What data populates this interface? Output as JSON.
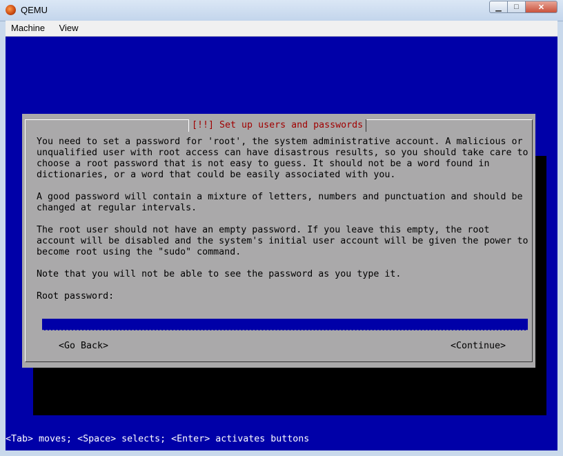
{
  "window": {
    "title": "QEMU",
    "minimize_label": "▁",
    "maximize_label": "□",
    "close_label": "✕"
  },
  "menu": [
    "Machine",
    "View"
  ],
  "dialog": {
    "title": "[!!] Set up users and passwords",
    "paragraphs": [
      "You need to set a password for 'root', the system administrative account. A malicious or\nunqualified user with root access can have disastrous results, so you should take care to\nchoose a root password that is not easy to guess. It should not be a word found in\ndictionaries, or a word that could be easily associated with you.",
      "A good password will contain a mixture of letters, numbers and punctuation and should be\nchanged at regular intervals.",
      "The root user should not have an empty password. If you leave this empty, the root\naccount will be disabled and the system's initial user account will be given the power to\nbecome root using the \"sudo\" command.",
      "Note that you will not be able to see the password as you type it."
    ],
    "prompt_label": "Root password:",
    "password_value": "",
    "go_back_label": "<Go Back>",
    "continue_label": "<Continue>"
  },
  "status_bar": "<Tab> moves; <Space> selects; <Enter> activates buttons",
  "colors": {
    "screen_bg": "#0000a8",
    "dialog_bg": "#aaa9aa",
    "title_text": "#a00000",
    "input_bg": "#0000a8"
  }
}
